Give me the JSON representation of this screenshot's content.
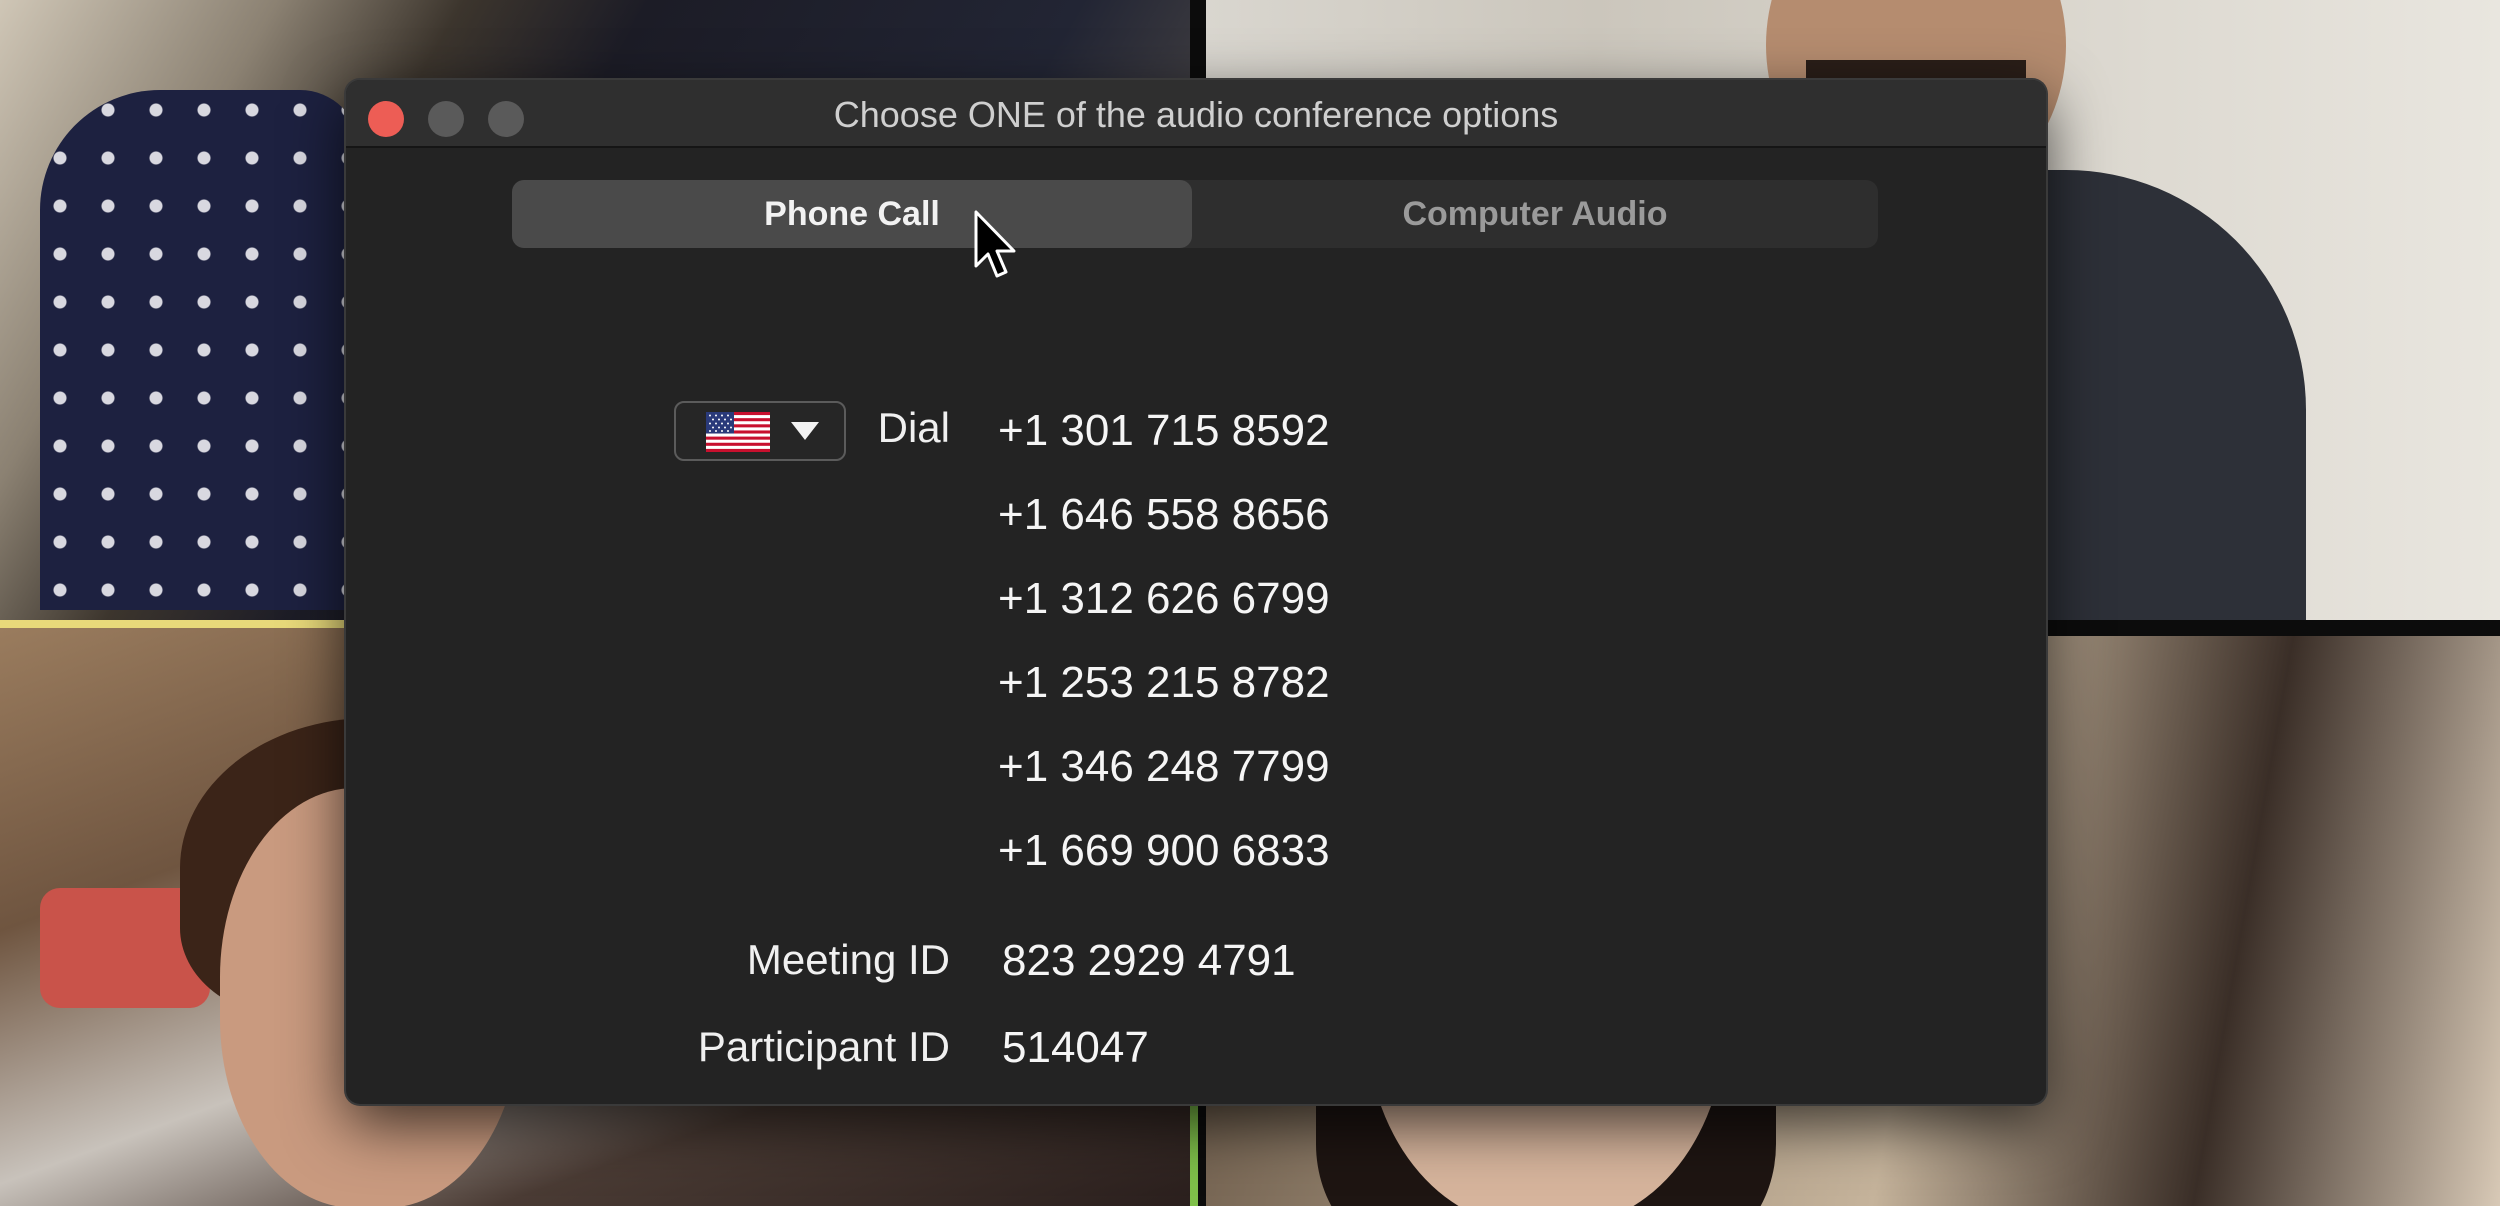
{
  "window": {
    "title": "Choose ONE of the audio conference options"
  },
  "tabs": [
    {
      "label": "Phone Call",
      "active": true
    },
    {
      "label": "Computer Audio",
      "active": false
    }
  ],
  "dial": {
    "country": "United States",
    "country_icon": "us-flag-icon",
    "label": "Dial",
    "numbers": [
      "+1 301 715 8592",
      "+1 646 558 8656",
      "+1 312 626 6799",
      "+1 253 215 8782",
      "+1 346 248 7799",
      "+1 669 900 6833"
    ]
  },
  "meeting": {
    "meeting_id_label": "Meeting ID",
    "meeting_id": "823 2929 4791",
    "participant_id_label": "Participant ID",
    "participant_id": "514047"
  },
  "colors": {
    "close_button": "#ed5d55",
    "dialog_bg": "#232323",
    "active_speaker_border": "#e8d97a"
  }
}
